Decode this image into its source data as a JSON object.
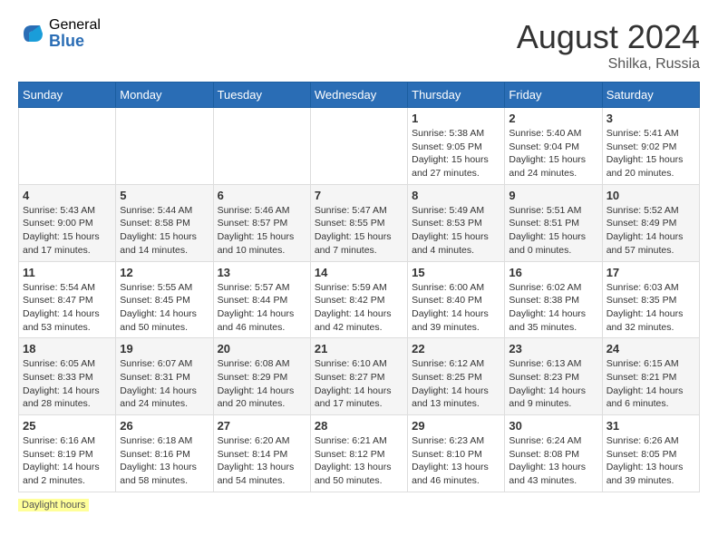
{
  "header": {
    "logo_general": "General",
    "logo_blue": "Blue",
    "month_year": "August 2024",
    "location": "Shilka, Russia"
  },
  "days_of_week": [
    "Sunday",
    "Monday",
    "Tuesday",
    "Wednesday",
    "Thursday",
    "Friday",
    "Saturday"
  ],
  "weeks": [
    [
      {
        "day": "",
        "info": ""
      },
      {
        "day": "",
        "info": ""
      },
      {
        "day": "",
        "info": ""
      },
      {
        "day": "",
        "info": ""
      },
      {
        "day": "1",
        "info": "Sunrise: 5:38 AM\nSunset: 9:05 PM\nDaylight: 15 hours and 27 minutes."
      },
      {
        "day": "2",
        "info": "Sunrise: 5:40 AM\nSunset: 9:04 PM\nDaylight: 15 hours and 24 minutes."
      },
      {
        "day": "3",
        "info": "Sunrise: 5:41 AM\nSunset: 9:02 PM\nDaylight: 15 hours and 20 minutes."
      }
    ],
    [
      {
        "day": "4",
        "info": "Sunrise: 5:43 AM\nSunset: 9:00 PM\nDaylight: 15 hours and 17 minutes."
      },
      {
        "day": "5",
        "info": "Sunrise: 5:44 AM\nSunset: 8:58 PM\nDaylight: 15 hours and 14 minutes."
      },
      {
        "day": "6",
        "info": "Sunrise: 5:46 AM\nSunset: 8:57 PM\nDaylight: 15 hours and 10 minutes."
      },
      {
        "day": "7",
        "info": "Sunrise: 5:47 AM\nSunset: 8:55 PM\nDaylight: 15 hours and 7 minutes."
      },
      {
        "day": "8",
        "info": "Sunrise: 5:49 AM\nSunset: 8:53 PM\nDaylight: 15 hours and 4 minutes."
      },
      {
        "day": "9",
        "info": "Sunrise: 5:51 AM\nSunset: 8:51 PM\nDaylight: 15 hours and 0 minutes."
      },
      {
        "day": "10",
        "info": "Sunrise: 5:52 AM\nSunset: 8:49 PM\nDaylight: 14 hours and 57 minutes."
      }
    ],
    [
      {
        "day": "11",
        "info": "Sunrise: 5:54 AM\nSunset: 8:47 PM\nDaylight: 14 hours and 53 minutes."
      },
      {
        "day": "12",
        "info": "Sunrise: 5:55 AM\nSunset: 8:45 PM\nDaylight: 14 hours and 50 minutes."
      },
      {
        "day": "13",
        "info": "Sunrise: 5:57 AM\nSunset: 8:44 PM\nDaylight: 14 hours and 46 minutes."
      },
      {
        "day": "14",
        "info": "Sunrise: 5:59 AM\nSunset: 8:42 PM\nDaylight: 14 hours and 42 minutes."
      },
      {
        "day": "15",
        "info": "Sunrise: 6:00 AM\nSunset: 8:40 PM\nDaylight: 14 hours and 39 minutes."
      },
      {
        "day": "16",
        "info": "Sunrise: 6:02 AM\nSunset: 8:38 PM\nDaylight: 14 hours and 35 minutes."
      },
      {
        "day": "17",
        "info": "Sunrise: 6:03 AM\nSunset: 8:35 PM\nDaylight: 14 hours and 32 minutes."
      }
    ],
    [
      {
        "day": "18",
        "info": "Sunrise: 6:05 AM\nSunset: 8:33 PM\nDaylight: 14 hours and 28 minutes."
      },
      {
        "day": "19",
        "info": "Sunrise: 6:07 AM\nSunset: 8:31 PM\nDaylight: 14 hours and 24 minutes."
      },
      {
        "day": "20",
        "info": "Sunrise: 6:08 AM\nSunset: 8:29 PM\nDaylight: 14 hours and 20 minutes."
      },
      {
        "day": "21",
        "info": "Sunrise: 6:10 AM\nSunset: 8:27 PM\nDaylight: 14 hours and 17 minutes."
      },
      {
        "day": "22",
        "info": "Sunrise: 6:12 AM\nSunset: 8:25 PM\nDaylight: 14 hours and 13 minutes."
      },
      {
        "day": "23",
        "info": "Sunrise: 6:13 AM\nSunset: 8:23 PM\nDaylight: 14 hours and 9 minutes."
      },
      {
        "day": "24",
        "info": "Sunrise: 6:15 AM\nSunset: 8:21 PM\nDaylight: 14 hours and 6 minutes."
      }
    ],
    [
      {
        "day": "25",
        "info": "Sunrise: 6:16 AM\nSunset: 8:19 PM\nDaylight: 14 hours and 2 minutes."
      },
      {
        "day": "26",
        "info": "Sunrise: 6:18 AM\nSunset: 8:16 PM\nDaylight: 13 hours and 58 minutes."
      },
      {
        "day": "27",
        "info": "Sunrise: 6:20 AM\nSunset: 8:14 PM\nDaylight: 13 hours and 54 minutes."
      },
      {
        "day": "28",
        "info": "Sunrise: 6:21 AM\nSunset: 8:12 PM\nDaylight: 13 hours and 50 minutes."
      },
      {
        "day": "29",
        "info": "Sunrise: 6:23 AM\nSunset: 8:10 PM\nDaylight: 13 hours and 46 minutes."
      },
      {
        "day": "30",
        "info": "Sunrise: 6:24 AM\nSunset: 8:08 PM\nDaylight: 13 hours and 43 minutes."
      },
      {
        "day": "31",
        "info": "Sunrise: 6:26 AM\nSunset: 8:05 PM\nDaylight: 13 hours and 39 minutes."
      }
    ]
  ],
  "footer": {
    "daylight_label": "Daylight hours"
  }
}
